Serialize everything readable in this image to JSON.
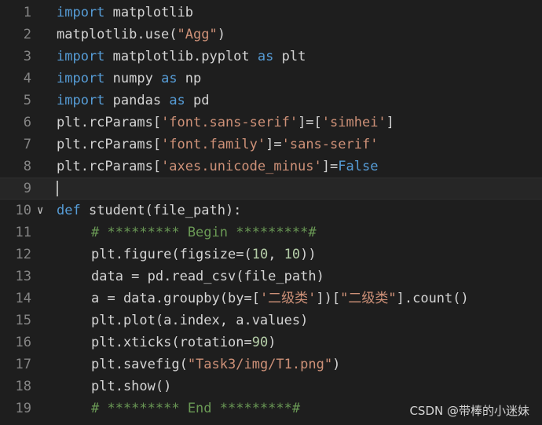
{
  "colors": {
    "background": "#1e1e1e",
    "keyword": "#569cd6",
    "string": "#ce9178",
    "comment": "#6a9955",
    "number": "#b5cea8",
    "text": "#d4d4d4",
    "line_number": "#858585"
  },
  "editor": {
    "lines": [
      {
        "n": "1",
        "tokens": [
          {
            "t": "kw",
            "v": "import"
          },
          {
            "t": "tx",
            "v": " matplotlib"
          }
        ]
      },
      {
        "n": "2",
        "tokens": [
          {
            "t": "tx",
            "v": "matplotlib.use("
          },
          {
            "t": "str",
            "v": "\"Agg\""
          },
          {
            "t": "tx",
            "v": ")"
          }
        ]
      },
      {
        "n": "3",
        "tokens": [
          {
            "t": "kw",
            "v": "import"
          },
          {
            "t": "tx",
            "v": " matplotlib.pyplot "
          },
          {
            "t": "kw",
            "v": "as"
          },
          {
            "t": "tx",
            "v": " plt"
          }
        ]
      },
      {
        "n": "4",
        "tokens": [
          {
            "t": "kw",
            "v": "import"
          },
          {
            "t": "tx",
            "v": " numpy "
          },
          {
            "t": "kw",
            "v": "as"
          },
          {
            "t": "tx",
            "v": " np"
          }
        ]
      },
      {
        "n": "5",
        "tokens": [
          {
            "t": "kw",
            "v": "import"
          },
          {
            "t": "tx",
            "v": " pandas "
          },
          {
            "t": "kw",
            "v": "as"
          },
          {
            "t": "tx",
            "v": " pd"
          }
        ]
      },
      {
        "n": "6",
        "tokens": [
          {
            "t": "tx",
            "v": "plt.rcParams["
          },
          {
            "t": "str",
            "v": "'font.sans-serif'"
          },
          {
            "t": "tx",
            "v": "]=["
          },
          {
            "t": "str",
            "v": "'simhei'"
          },
          {
            "t": "tx",
            "v": "]"
          }
        ]
      },
      {
        "n": "7",
        "tokens": [
          {
            "t": "tx",
            "v": "plt.rcParams["
          },
          {
            "t": "str",
            "v": "'font.family'"
          },
          {
            "t": "tx",
            "v": "]="
          },
          {
            "t": "str",
            "v": "'sans-serif'"
          }
        ]
      },
      {
        "n": "8",
        "tokens": [
          {
            "t": "tx",
            "v": "plt.rcParams["
          },
          {
            "t": "str",
            "v": "'axes.unicode_minus'"
          },
          {
            "t": "tx",
            "v": "]="
          },
          {
            "t": "kw",
            "v": "False"
          }
        ]
      },
      {
        "n": "9",
        "tokens": [],
        "current": true
      },
      {
        "n": "10",
        "fold": "∨",
        "tokens": [
          {
            "t": "kw",
            "v": "def"
          },
          {
            "t": "tx",
            "v": " student(file_path):"
          }
        ]
      },
      {
        "n": "11",
        "indent": 1,
        "tokens": [
          {
            "t": "cmt",
            "v": "# ********* Begin *********#"
          }
        ]
      },
      {
        "n": "12",
        "indent": 1,
        "tokens": [
          {
            "t": "tx",
            "v": "plt.figure(figsize=("
          },
          {
            "t": "num",
            "v": "10"
          },
          {
            "t": "tx",
            "v": ", "
          },
          {
            "t": "num",
            "v": "10"
          },
          {
            "t": "tx",
            "v": "))"
          }
        ]
      },
      {
        "n": "13",
        "indent": 1,
        "tokens": [
          {
            "t": "tx",
            "v": "data = pd.read_csv(file_path)"
          }
        ]
      },
      {
        "n": "14",
        "indent": 1,
        "tokens": [
          {
            "t": "tx",
            "v": "a = data.groupby(by=["
          },
          {
            "t": "str",
            "v": "'二级类'"
          },
          {
            "t": "tx",
            "v": "])["
          },
          {
            "t": "str",
            "v": "\"二级类\""
          },
          {
            "t": "tx",
            "v": "].count()"
          }
        ]
      },
      {
        "n": "15",
        "indent": 1,
        "tokens": [
          {
            "t": "tx",
            "v": "plt.plot(a.index, a.values)"
          }
        ]
      },
      {
        "n": "16",
        "indent": 1,
        "tokens": [
          {
            "t": "tx",
            "v": "plt.xticks(rotation="
          },
          {
            "t": "num",
            "v": "90"
          },
          {
            "t": "tx",
            "v": ")"
          }
        ]
      },
      {
        "n": "17",
        "indent": 1,
        "tokens": [
          {
            "t": "tx",
            "v": "plt.savefig("
          },
          {
            "t": "str",
            "v": "\"Task3/img/T1.png\""
          },
          {
            "t": "tx",
            "v": ")"
          }
        ]
      },
      {
        "n": "18",
        "indent": 1,
        "tokens": [
          {
            "t": "tx",
            "v": "plt.show()"
          }
        ]
      },
      {
        "n": "19",
        "indent": 1,
        "tokens": [
          {
            "t": "cmt",
            "v": "# ********* End *********#"
          }
        ]
      }
    ]
  },
  "watermark": "CSDN @带棒的小迷妹"
}
